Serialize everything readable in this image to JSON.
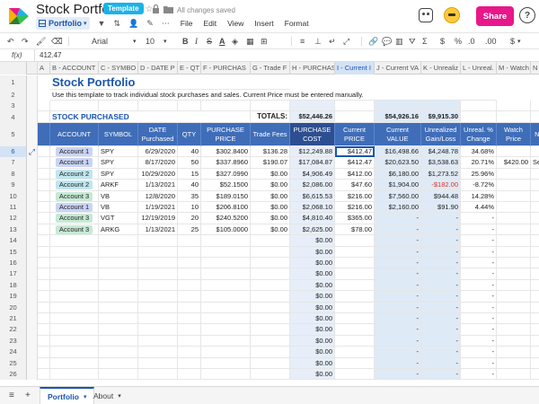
{
  "app": {
    "title": "Stock Portfolio",
    "badge": "Template",
    "saved_status": "All changes saved",
    "page_selector": "Portfolio",
    "menu": [
      "File",
      "Edit",
      "View",
      "Insert",
      "Format"
    ],
    "share_label": "Share",
    "help_label": "?"
  },
  "toolbar": {
    "font": "Arial",
    "font_size": "10",
    "bold": "B",
    "italic": "I",
    "strike": "S",
    "underline_a": "A",
    "dollar": "$",
    "percent": "%",
    "dec_dec": ".0",
    "dec_inc": ".00",
    "currency": "$"
  },
  "formula": {
    "fx": "f(x)",
    "value": "412.47"
  },
  "columns": [
    {
      "label": "A",
      "w": 14
    },
    {
      "label": "B - ACCOUNT",
      "w": 54
    },
    {
      "label": "C - SYMBO",
      "w": 44
    },
    {
      "label": "D - DATE P",
      "w": 44
    },
    {
      "label": "E - QT",
      "w": 26
    },
    {
      "label": "F - PURCHAS",
      "w": 55
    },
    {
      "label": "G - Trade F",
      "w": 44
    },
    {
      "label": "H - PURCHAS",
      "w": 50
    },
    {
      "label": "I - Current I",
      "w": 44
    },
    {
      "label": "J - Current VA",
      "w": 52
    },
    {
      "label": "K - Unrealiz",
      "w": 44
    },
    {
      "label": "L - Unreal.",
      "w": 40
    },
    {
      "label": "M - Watch",
      "w": 38
    },
    {
      "label": "N -",
      "w": 30
    }
  ],
  "sheet": {
    "heading": "Stock Portfolio",
    "description": "Use this template to track individual stock purchases and sales. Current Price must be entered manually.",
    "section_title": "STOCK PURCHASED",
    "totals_label": "TOTALS:",
    "total_purchase": "$52,446.26",
    "total_current_value": "$54,926.16",
    "total_unrealized": "$9,915.30",
    "headers": {
      "account": "ACCOUNT",
      "symbol": "SYMBOL",
      "date": [
        "DATE",
        "Purchased"
      ],
      "qty": "QTY",
      "price": [
        "PURCHASE",
        "PRICE"
      ],
      "fees": "Trade Fees",
      "cost": [
        "PURCHASE",
        "COST"
      ],
      "current_price": [
        "Current",
        "PRICE"
      ],
      "current_value": [
        "Current",
        "VALUE"
      ],
      "unrealized": [
        "Unrealized",
        "Gain/Loss"
      ],
      "unreal_pct": [
        "Unreal. %",
        "Change"
      ],
      "watch": [
        "Watch",
        "Price"
      ],
      "note": "NOTE"
    },
    "rows": [
      {
        "n": "6",
        "account": "Account 1",
        "acolor": "#c9d4f5",
        "symbol": "SPY",
        "date": "6/29/2020",
        "qty": "40",
        "price": "$302.8400",
        "fees": "$136.28",
        "cost": "$12,249.88",
        "cur": "$412.47",
        "val": "$16,498.66",
        "gain": "$4,248.78",
        "pct": "34.68%",
        "watch": "",
        "note": ""
      },
      {
        "n": "7",
        "account": "Account 1",
        "acolor": "#c9d4f5",
        "symbol": "SPY",
        "date": "8/17/2020",
        "qty": "50",
        "price": "$337.8960",
        "fees": "$190.07",
        "cost": "$17,084.87",
        "cur": "$412.47",
        "val": "$20,623.50",
        "gain": "$3,538.63",
        "pct": "20.71%",
        "watch": "$420.00",
        "note": "Sell Lin"
      },
      {
        "n": "8",
        "account": "Account 2",
        "acolor": "#bfe6ee",
        "symbol": "SPY",
        "date": "10/29/2020",
        "qty": "15",
        "price": "$327.0990",
        "fees": "$0.00",
        "cost": "$4,906.49",
        "cur": "$412.00",
        "val": "$6,180.00",
        "gain": "$1,273.52",
        "pct": "25.96%",
        "watch": "",
        "note": ""
      },
      {
        "n": "9",
        "account": "Account 2",
        "acolor": "#bfe6ee",
        "symbol": "ARKF",
        "date": "1/13/2021",
        "qty": "40",
        "price": "$52.1500",
        "fees": "$0.00",
        "cost": "$2,086.00",
        "cur": "$47.60",
        "val": "$1,904.00",
        "gain": "-$182.00",
        "pct": "-8.72%",
        "watch": "",
        "note": ""
      },
      {
        "n": "10",
        "account": "Account 3",
        "acolor": "#c6e9d5",
        "symbol": "VB",
        "date": "12/8/2020",
        "qty": "35",
        "price": "$189.0150",
        "fees": "$0.00",
        "cost": "$6,615.53",
        "cur": "$216.00",
        "val": "$7,560.00",
        "gain": "$944.48",
        "pct": "14.28%",
        "watch": "",
        "note": ""
      },
      {
        "n": "11",
        "account": "Account 1",
        "acolor": "#c9d4f5",
        "symbol": "VB",
        "date": "1/19/2021",
        "qty": "10",
        "price": "$206.8100",
        "fees": "$0.00",
        "cost": "$2,068.10",
        "cur": "$216.00",
        "val": "$2,160.00",
        "gain": "$91.90",
        "pct": "4.44%",
        "watch": "",
        "note": ""
      },
      {
        "n": "12",
        "account": "Account 3",
        "acolor": "#c6e9d5",
        "symbol": "VGT",
        "date": "12/19/2019",
        "qty": "20",
        "price": "$240.5200",
        "fees": "$0.00",
        "cost": "$4,810.40",
        "cur": "$365.00",
        "val": "-",
        "gain": "-",
        "pct": "-",
        "watch": "",
        "note": ""
      },
      {
        "n": "13",
        "account": "Account 3",
        "acolor": "#c6e9d5",
        "symbol": "ARKG",
        "date": "1/13/2021",
        "qty": "25",
        "price": "$105.0000",
        "fees": "$0.00",
        "cost": "$2,625.00",
        "cur": "$78.00",
        "val": "-",
        "gain": "-",
        "pct": "-",
        "watch": "",
        "note": ""
      }
    ],
    "empty_row_numbers": [
      "14",
      "15",
      "16",
      "17",
      "18",
      "19",
      "20",
      "21",
      "22",
      "23",
      "24",
      "25",
      "26"
    ],
    "empty_cost": "$0.00",
    "empty_dash": "-"
  },
  "tabs": {
    "sheets": [
      "Portfolio",
      "About"
    ],
    "active": "Portfolio"
  },
  "colors": {
    "heading": "#1a56b0",
    "header_bg": "#3f6db8",
    "accent": "#1a56b0",
    "share": "#e8178a",
    "negative": "#d93025",
    "cost_col_bg": "#e7eef9",
    "value_col_bg": "#dfeaf7"
  }
}
